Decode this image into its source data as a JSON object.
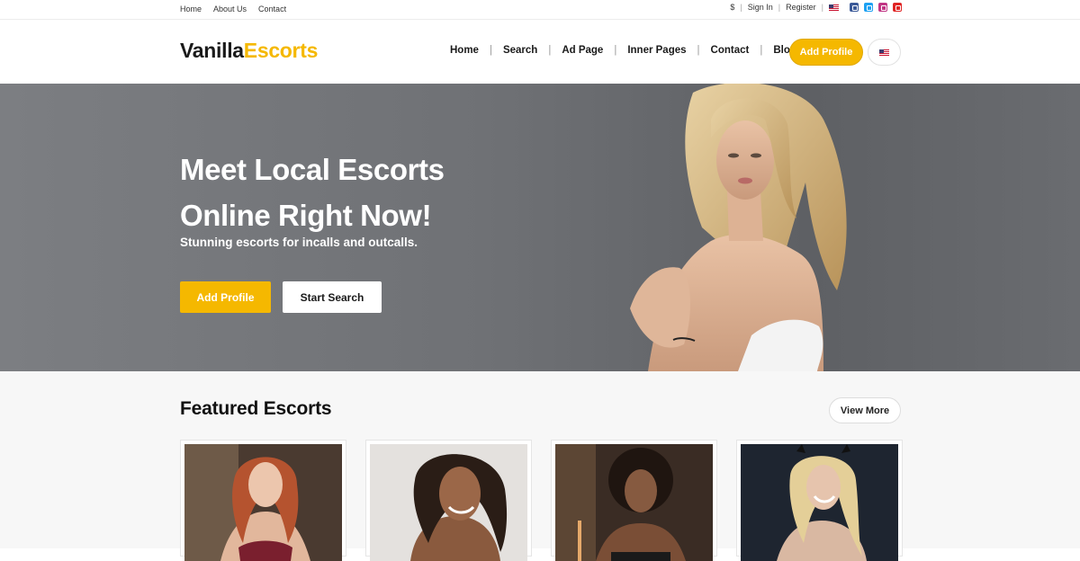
{
  "topbar": {
    "links": [
      "Home",
      "About Us",
      "Contact"
    ],
    "currency": "$",
    "sign_in": "Sign In",
    "register": "Register"
  },
  "header": {
    "logo_part1": "Vanilla",
    "logo_part2": "Escorts",
    "nav": [
      "Home",
      "Search",
      "Ad Page",
      "Inner Pages",
      "Contact",
      "Blog"
    ],
    "add_profile": "Add Profile"
  },
  "hero": {
    "title_line1": "Meet Local Escorts",
    "title_line2": "Online Right Now!",
    "subtitle": "Stunning escorts for incalls and outcalls.",
    "btn_add": "Add Profile",
    "btn_search": "Start Search"
  },
  "featured": {
    "title": "Featured Escorts",
    "view_more": "View More"
  },
  "colors": {
    "accent": "#f5b800",
    "facebook": "#3b5998",
    "twitter": "#1da1f2",
    "instagram": "#c13584",
    "youtube": "#e02424"
  },
  "icons": [
    "us-flag-icon",
    "facebook-icon",
    "twitter-icon",
    "instagram-icon",
    "youtube-icon"
  ]
}
